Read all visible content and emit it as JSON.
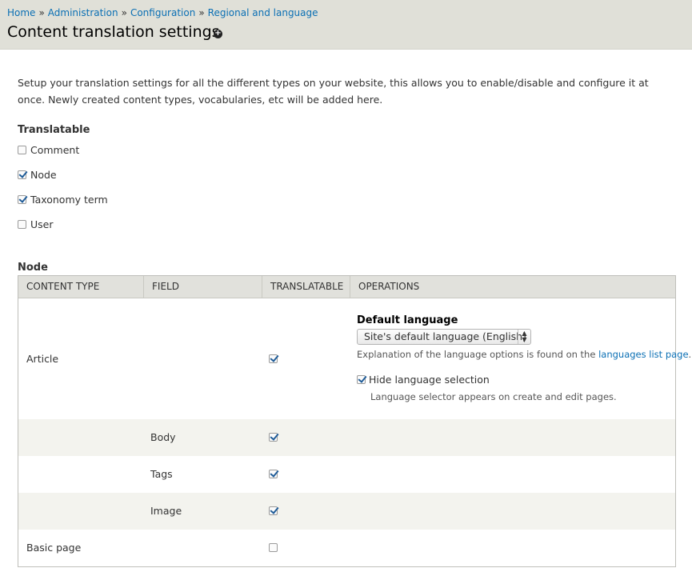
{
  "breadcrumb": {
    "items": [
      "Home",
      "Administration",
      "Configuration",
      "Regional and language"
    ],
    "separator": "»"
  },
  "page": {
    "title": "Content translation settings",
    "shortcut_icon": "plus-circle-icon"
  },
  "intro": "Setup your translation settings for all the different types on your website, this allows you to enable/disable and configure it at once. Newly created content types, vocabularies, etc will be added here.",
  "translatable": {
    "label": "Translatable",
    "options": [
      {
        "label": "Comment",
        "checked": false
      },
      {
        "label": "Node",
        "checked": true
      },
      {
        "label": "Taxonomy term",
        "checked": true
      },
      {
        "label": "User",
        "checked": false
      }
    ]
  },
  "node_section": {
    "label": "Node",
    "headers": [
      "CONTENT TYPE",
      "FIELD",
      "TRANSLATABLE",
      "OPERATIONS"
    ],
    "rows": [
      {
        "content_type": "Article",
        "field": "",
        "translatable": true
      },
      {
        "content_type": "",
        "field": "Body",
        "translatable": true
      },
      {
        "content_type": "",
        "field": "Tags",
        "translatable": true
      },
      {
        "content_type": "",
        "field": "Image",
        "translatable": true
      },
      {
        "content_type": "Basic page",
        "field": "",
        "translatable": false
      }
    ],
    "operations": {
      "default_language_label": "Default language",
      "default_language_value": "Site's default language (English)",
      "explanation_prefix": "Explanation of the language options is found on the",
      "explanation_link": "languages list page",
      "explanation_suffix": ".",
      "hide_selection_label": "Hide language selection",
      "hide_selection_checked": true,
      "hide_selection_description": "Language selector appears on create and edit pages."
    }
  },
  "colors": {
    "link": "#0a6fb4",
    "header_bg": "#e0e0d8",
    "table_header_bg": "#e1e1dc",
    "row_alt_bg": "#f3f3ee"
  }
}
